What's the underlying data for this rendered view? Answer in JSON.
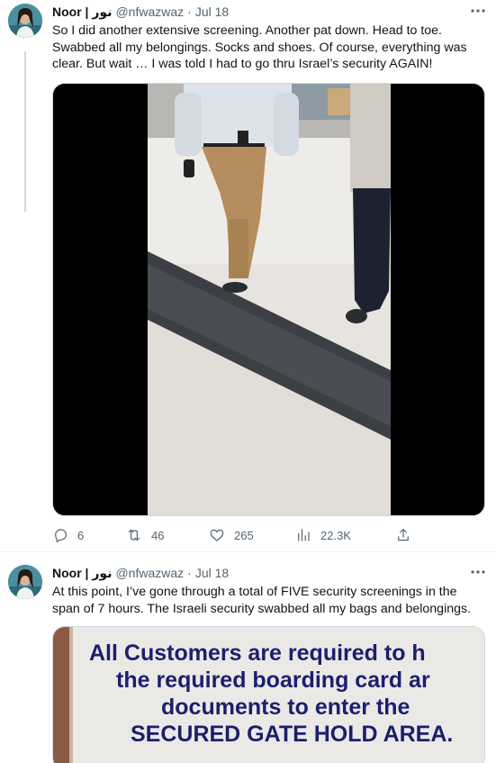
{
  "colors": {
    "text_primary": "#0f1419",
    "text_secondary": "#536471",
    "border": "#cfd9de",
    "sign_text": "#1b1f6e"
  },
  "tweets": [
    {
      "name": "Noor | نور",
      "handle": "@nfwazwaz",
      "separator": "·",
      "date": "Jul 18",
      "text": "So I did another extensive screening. Another pat down. Head to toe. Swabbed all my belongings. Socks and shoes. Of course, everything was clear. But wait … I was told I had to go thru Israel’s security AGAIN!",
      "media": "video",
      "actions": {
        "replies": "6",
        "retweets": "46",
        "likes": "265",
        "views": "22.3K"
      }
    },
    {
      "name": "Noor | نور",
      "handle": "@nfwazwaz",
      "separator": "·",
      "date": "Jul 18",
      "text": "At this point, I’ve gone through a total of FIVE security screenings in the span of 7 hours. The Israeli security swabbed all my bags and belongings.",
      "media": "photo",
      "sign_lines": [
        "All Customers are required to h",
        "the required boarding card ar",
        "documents to enter the",
        "SECURED GATE HOLD AREA."
      ]
    }
  ],
  "icons": {
    "more": "more-icon",
    "reply": "reply-icon",
    "retweet": "retweet-icon",
    "like": "heart-icon",
    "views": "views-icon",
    "share": "share-icon"
  }
}
